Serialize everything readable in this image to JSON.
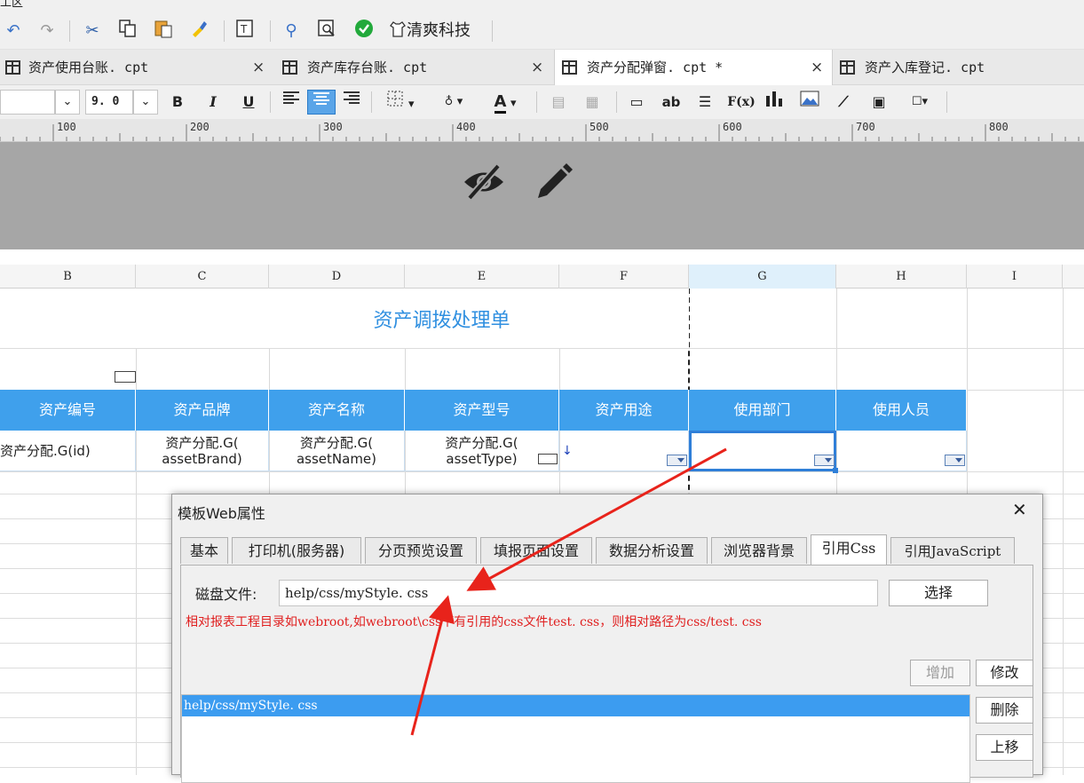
{
  "window": {
    "title_fragment": "工区"
  },
  "toolbar": {
    "brand": "清爽科技"
  },
  "tabs": [
    {
      "label": "资产使用台账. cpt",
      "close": "×"
    },
    {
      "label": "资产库存台账. cpt",
      "close": "×"
    },
    {
      "label": "资产分配弹窗. cpt *",
      "close": "×"
    },
    {
      "label": "资产入库登记. cpt"
    }
  ],
  "format_toolbar": {
    "font_size": "9. 0",
    "bold": "B",
    "italic": "I",
    "underline": "U",
    "ab": "ab",
    "fx": "F(x)",
    "color_letter": "A"
  },
  "ruler": {
    "labels": [
      "100",
      "200",
      "300",
      "400",
      "500",
      "600",
      "700",
      "800"
    ]
  },
  "columns": [
    "B",
    "C",
    "D",
    "E",
    "F",
    "G",
    "H",
    "I"
  ],
  "sheet": {
    "title": "资产调拨处理单",
    "headers": [
      "资产编号",
      "资产品牌",
      "资产名称",
      "资产型号",
      "资产用途",
      "使用部门",
      "使用人员"
    ],
    "row": [
      {
        "l1": "资产分配.G(id)",
        "l2": ""
      },
      {
        "l1": "资产分配.G(",
        "l2": "assetBrand)"
      },
      {
        "l1": "资产分配.G(",
        "l2": "assetName)"
      },
      {
        "l1": "资产分配.G(",
        "l2": "assetType)"
      }
    ]
  },
  "dialog": {
    "title": "模板Web属性",
    "close": "✕",
    "tabs": [
      "基本",
      "打印机(服务器)",
      "分页预览设置",
      "填报页面设置",
      "数据分析设置",
      "浏览器背景",
      "引用Css",
      "引用JavaScript"
    ],
    "disk_label": "磁盘文件:",
    "disk_value": "help/css/myStyle. css",
    "select_btn": "选择",
    "hint": "相对报表工程目录如webroot,如webroot\\css下有引用的css文件test. css，则相对路径为css/test. css",
    "add_btn": "增加",
    "modify_btn": "修改",
    "delete_btn": "删除",
    "up_btn": "上移",
    "list_items": [
      "help/css/myStyle. css"
    ]
  }
}
